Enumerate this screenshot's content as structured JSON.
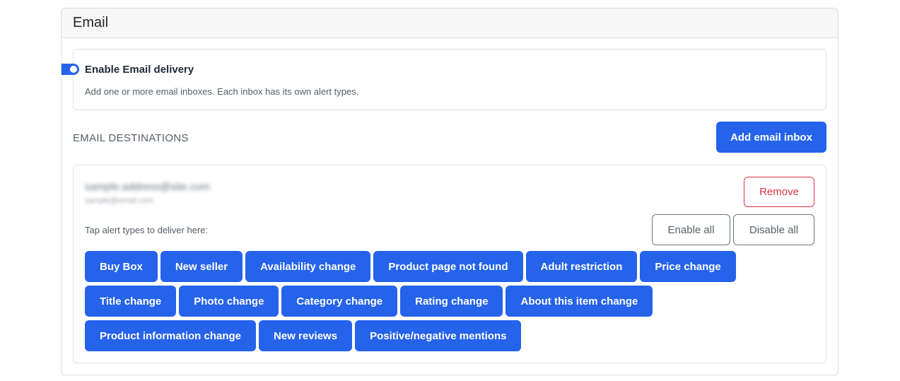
{
  "section": {
    "title": "Email"
  },
  "delivery": {
    "enabled": true,
    "title": "Enable Email delivery",
    "description": "Add one or more email inboxes. Each inbox has its own alert types."
  },
  "destinations": {
    "label": "EMAIL DESTINATIONS",
    "add_label": "Add email inbox"
  },
  "inbox": {
    "email": "sample.address@site.com",
    "sub": "sample@email.com",
    "remove_label": "Remove",
    "tap_label": "Tap alert types to deliver here:",
    "enable_all_label": "Enable all",
    "disable_all_label": "Disable all",
    "alert_rows": [
      [
        "Buy Box",
        "New seller",
        "Availability change",
        "Product page not found",
        "Adult restriction",
        "Price change"
      ],
      [
        "Title change",
        "Photo change",
        "Category change",
        "Rating change",
        "About this item change"
      ],
      [
        "Product information change",
        "New reviews",
        "Positive/negative mentions"
      ]
    ]
  },
  "colors": {
    "accent": "#2563eb",
    "danger": "#dc3545",
    "outline": "#6c757d"
  }
}
